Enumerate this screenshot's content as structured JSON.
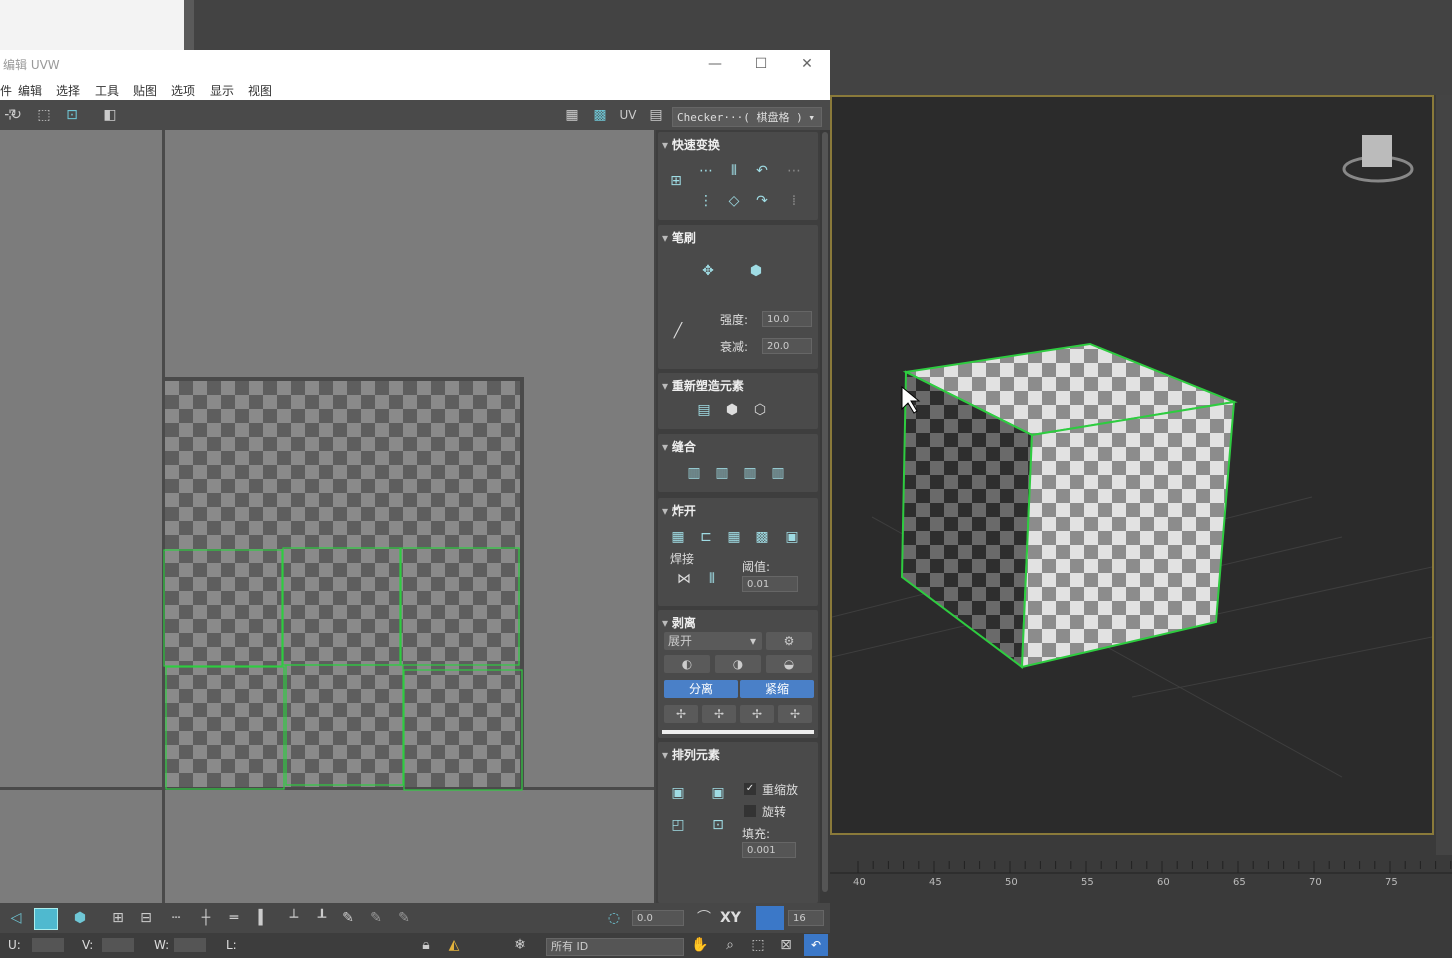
{
  "window": {
    "title": "编辑 UVW",
    "minimize": "—",
    "maximize": "☐",
    "close": "✕"
  },
  "menu": [
    "件",
    "编辑",
    "选择",
    "工具",
    "贴图",
    "选项",
    "显示",
    "视图"
  ],
  "toolbar": {
    "uv_label": "UV",
    "texture_select": "Checker···( 棋盘格 )",
    "dropdown_arrow": "▾"
  },
  "panel": {
    "quick_transform": {
      "title": "快速变换"
    },
    "brush": {
      "title": "笔刷",
      "strength_label": "强度:",
      "strength_value": "10.0",
      "falloff_label": "衰减:",
      "falloff_value": "20.0"
    },
    "reshape": {
      "title": "重新塑造元素"
    },
    "stitch": {
      "title": "缝合"
    },
    "explode": {
      "title": "炸开",
      "weld_label": "焊接",
      "threshold_label": "阈值:",
      "threshold_value": "0.01"
    },
    "peel": {
      "title": "剥离",
      "mode_select": "展开",
      "detach_label": "分离",
      "tighten_label": "紧缩"
    },
    "arrange": {
      "title": "排列元素",
      "rescale_label": "重缩放",
      "rescale_checked": true,
      "rotate_label": "旋转",
      "rotate_checked": false,
      "padding_label": "填充:",
      "padding_value": "0.001"
    }
  },
  "bottom": {
    "rotate_value": "0.0",
    "axis_label": "XY",
    "grid_value": "16"
  },
  "status": {
    "u_label": "U:",
    "v_label": "V:",
    "w_label": "W:",
    "l_label": "L:",
    "filter_select": "所有 ID"
  },
  "timeline": {
    "ticks": [
      "40",
      "45",
      "50",
      "55",
      "60",
      "65",
      "70",
      "75"
    ]
  },
  "colors": {
    "accent_blue": "#4a80c8",
    "selection_green": "#2ecc40",
    "viewport_border": "#8a7a3a"
  }
}
